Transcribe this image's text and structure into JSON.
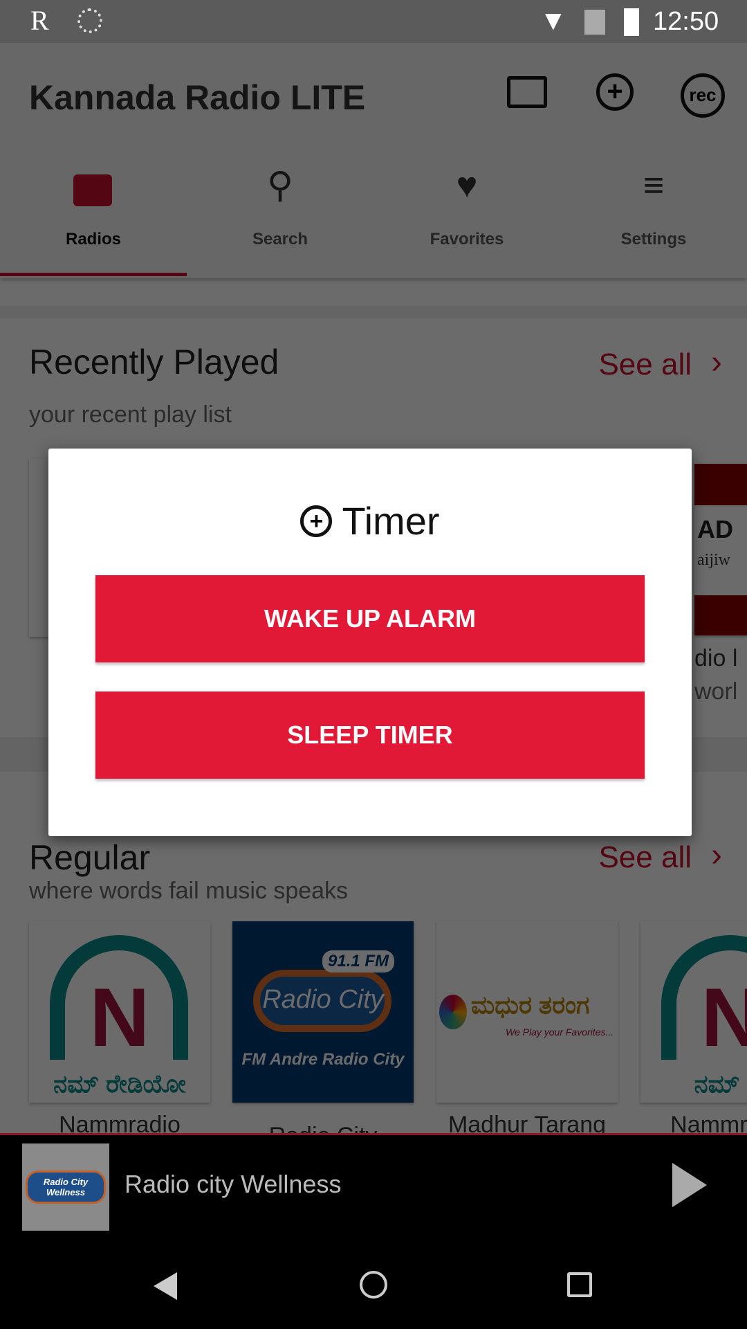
{
  "status_bar": {
    "time": "12:50",
    "icons": [
      "app-r-icon",
      "sync-icon",
      "wifi-icon",
      "no-sim-icon",
      "battery-charging-icon"
    ]
  },
  "app": {
    "title": "Kannada Radio LITE",
    "actions": [
      "cast-icon",
      "alarm-add-icon",
      "rec-icon"
    ],
    "rec_label": "rec"
  },
  "tabs": [
    {
      "label": "Radios",
      "icon": "radio-icon",
      "active": true
    },
    {
      "label": "Search",
      "icon": "search-icon"
    },
    {
      "label": "Favorites",
      "icon": "heart-icon"
    },
    {
      "label": "Settings",
      "icon": "menu-icon"
    }
  ],
  "recent": {
    "title": "Recently Played",
    "subtitle": "your recent play list",
    "see_all": "See all",
    "partial_texts": [
      "dio l",
      "worl",
      "AD",
      "aijiw"
    ]
  },
  "regular": {
    "title": "Regular",
    "subtitle": "where words fail music speaks",
    "see_all": "See all",
    "items": [
      {
        "name": "Nammradio",
        "logo_text": "N",
        "logo_sub": "ನಮ್ ರೇಡಿಯೋ"
      },
      {
        "name": "Radio City",
        "logo_text": "Radio City",
        "logo_top": "91.1 FM",
        "logo_sub": "FM Andre Radio City"
      },
      {
        "name": "Madhur Tarang",
        "logo_text": "ಮಧುರ ತರಂಗ",
        "logo_sub": "We Play your Favorites..."
      },
      {
        "name": "Nammradio",
        "logo_text": "N",
        "logo_sub": "ನಮ್ ರೇ"
      }
    ]
  },
  "dialog": {
    "title": "Timer",
    "icon": "alarm-add-icon",
    "buttons": [
      "WAKE UP ALARM",
      "SLEEP TIMER"
    ]
  },
  "player": {
    "station": "Radio city Wellness",
    "thumb_text": "Radio City Wellness",
    "state": "paused"
  },
  "colors": {
    "accent": "#e21936",
    "see_all": "#c8102e"
  }
}
